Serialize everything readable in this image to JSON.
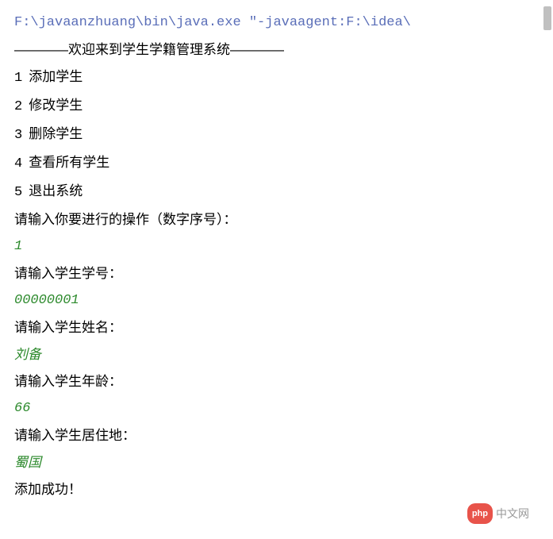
{
  "cmd": "F:\\javaanzhuang\\bin\\java.exe \"-javaagent:F:\\idea\\",
  "header": "————欢迎来到学生学籍管理系统————",
  "menu": [
    {
      "num": "1",
      "label": "添加学生"
    },
    {
      "num": "2",
      "label": "修改学生"
    },
    {
      "num": "3",
      "label": "删除学生"
    },
    {
      "num": "4",
      "label": "查看所有学生"
    },
    {
      "num": "5",
      "label": "退出系统"
    }
  ],
  "prompts": {
    "choose": "请输入你要进行的操作（数字序号）：",
    "student_id": "请输入学生学号：",
    "student_name": "请输入学生姓名：",
    "student_age": "请输入学生年龄：",
    "student_addr": "请输入学生居住地："
  },
  "inputs": {
    "choice": "1",
    "student_id": "00000001",
    "student_name": "刘备",
    "student_age": "66",
    "student_addr": "蜀国"
  },
  "result": "添加成功！",
  "watermark": {
    "badge": "php",
    "text": "中文网"
  }
}
